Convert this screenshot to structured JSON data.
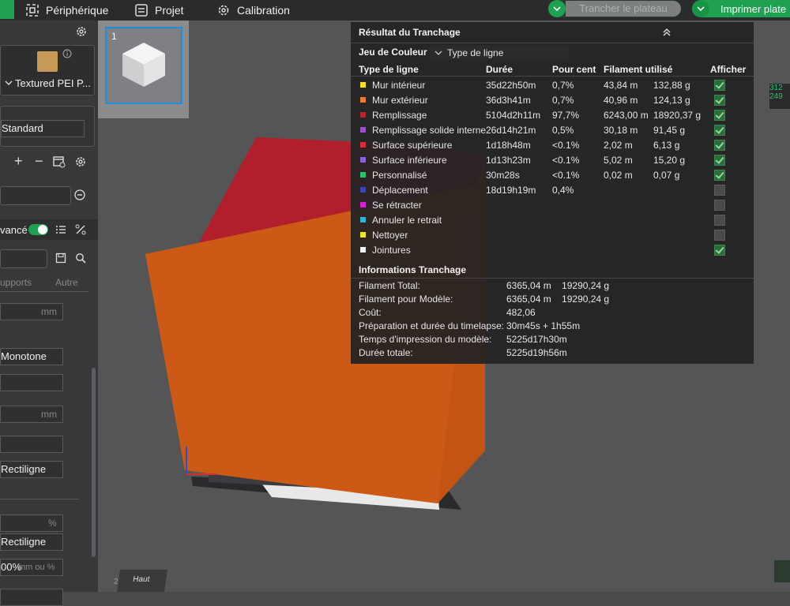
{
  "topbar": {
    "tabs": [
      {
        "label": "Périphérique",
        "icon": "device-icon"
      },
      {
        "label": "Projet",
        "icon": "project-icon"
      },
      {
        "label": "Calibration",
        "icon": "calibration-icon"
      }
    ],
    "slice_button": "Trancher le plateau",
    "print_button": "Imprimer plate"
  },
  "left_panel": {
    "plate_type": "Textured PEI P...",
    "preset": "Standard",
    "advanced_label": "vancé",
    "tabs": [
      "upports",
      "Autre"
    ],
    "fields": [
      {
        "value": "",
        "unit": "mm"
      },
      {
        "value": "Monotone",
        "unit": ""
      },
      {
        "value": "",
        "unit": ""
      },
      {
        "value": "",
        "unit": "mm"
      },
      {
        "value": "",
        "unit": ""
      },
      {
        "value": "Rectiligne",
        "unit": ""
      },
      {
        "value": "",
        "unit": "%"
      },
      {
        "value": "Rectiligne",
        "unit": ""
      },
      {
        "value": "00%",
        "unit": "mm ou %"
      }
    ]
  },
  "viewport": {
    "plate_number": "1",
    "view_cube_label": "Haut",
    "corner_label": "2"
  },
  "results": {
    "title": "Résultat du Tranchage",
    "color_scheme_label": "Jeu de Couleur",
    "color_scheme_value": "Type de ligne",
    "headers": {
      "type": "Type de ligne",
      "duration": "Durée",
      "percent": "Pour cent",
      "filament": "Filament utilisé",
      "show": "Afficher"
    },
    "rows": [
      {
        "color": "#f5e31a",
        "name": "Mur intérieur",
        "duration": "35d22h50m",
        "percent": "0,7%",
        "length": "43,84 m",
        "weight": "132,88 g",
        "shown": true
      },
      {
        "color": "#f0782a",
        "name": "Mur extérieur",
        "duration": "36d3h41m",
        "percent": "0,7%",
        "length": "40,96 m",
        "weight": "124,13 g",
        "shown": true
      },
      {
        "color": "#b8212d",
        "name": "Remplissage",
        "duration": "5104d2h11m",
        "percent": "97,7%",
        "length": "6243,00 m",
        "weight": "18920,37 g",
        "shown": true
      },
      {
        "color": "#9a4ec9",
        "name": "Remplissage solide interne",
        "duration": "26d14h21m",
        "percent": "0,5%",
        "length": "30,18 m",
        "weight": "91,45 g",
        "shown": true
      },
      {
        "color": "#e0283a",
        "name": "Surface supérieure",
        "duration": "1d18h48m",
        "percent": "<0.1%",
        "length": "2,02 m",
        "weight": "6,13 g",
        "shown": true
      },
      {
        "color": "#8a5fe6",
        "name": "Surface inférieure",
        "duration": "1d13h23m",
        "percent": "<0.1%",
        "length": "5,02 m",
        "weight": "15,20 g",
        "shown": true
      },
      {
        "color": "#1fc86a",
        "name": "Personnalisé",
        "duration": "30m28s",
        "percent": "<0.1%",
        "length": "0,02 m",
        "weight": "0,07 g",
        "shown": true
      },
      {
        "color": "#3a45b8",
        "name": "Déplacement",
        "duration": "18d19h19m",
        "percent": "0,4%",
        "length": "",
        "weight": "",
        "shown": false
      },
      {
        "color": "#d61fd6",
        "name": "Se rétracter",
        "duration": "",
        "percent": "",
        "length": "",
        "weight": "",
        "shown": false
      },
      {
        "color": "#2ab8d8",
        "name": "Annuler le retrait",
        "duration": "",
        "percent": "",
        "length": "",
        "weight": "",
        "shown": false
      },
      {
        "color": "#f2e61a",
        "name": "Nettoyer",
        "duration": "",
        "percent": "",
        "length": "",
        "weight": "",
        "shown": false
      },
      {
        "color": "#f2f2f2",
        "name": "Jointures",
        "duration": "",
        "percent": "",
        "length": "",
        "weight": "",
        "shown": true
      }
    ],
    "info_title": "Informations Tranchage",
    "info": [
      {
        "label": "Filament Total:",
        "value": "6365,04 m    19290,24 g"
      },
      {
        "label": "Filament pour Modèle:",
        "value": "6365,04 m    19290,24 g"
      },
      {
        "label": "Coût:",
        "value": "482,06"
      },
      {
        "label": "Préparation et durée du timelapse:",
        "value": "30m45s + 1h55m"
      },
      {
        "label": "Temps d'impression du modèle:",
        "value": "5225d17h30m"
      },
      {
        "label": "Durée totale:",
        "value": "5225d19h56m"
      }
    ]
  },
  "side_readout": [
    "312",
    "249"
  ]
}
